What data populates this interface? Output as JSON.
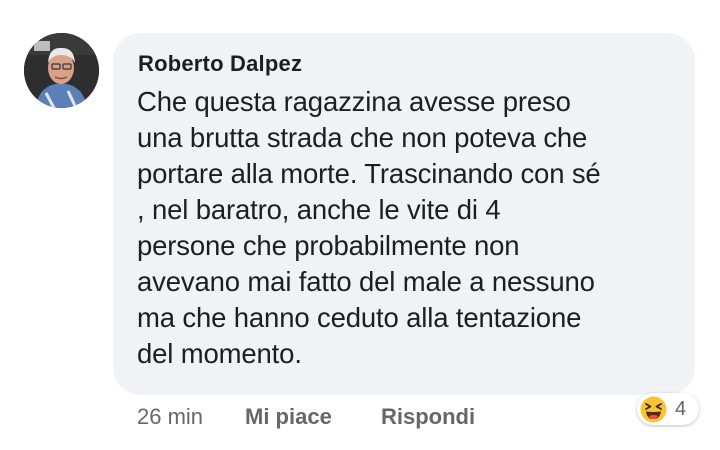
{
  "comment": {
    "author": "Roberto Dalpez",
    "lines": [
      "Che questa ragazzina avesse preso",
      "una brutta strada che non poteva che",
      "portare alla morte. Trascinando con sé",
      ", nel baratro, anche le vite di 4",
      "persone che probabilmente non",
      "avevano mai fatto del male a nessuno",
      "ma che hanno ceduto alla tentazione",
      "del momento."
    ]
  },
  "actions": {
    "time": "26 min",
    "like_label": "Mi piace",
    "reply_label": "Rispondi"
  },
  "reaction": {
    "icon": "laughing-emoji-icon",
    "count": "4"
  },
  "colors": {
    "bubble": "#f0f2f5",
    "text": "#1c1e21",
    "muted": "#65676b",
    "emoji": "#f7c33b"
  }
}
